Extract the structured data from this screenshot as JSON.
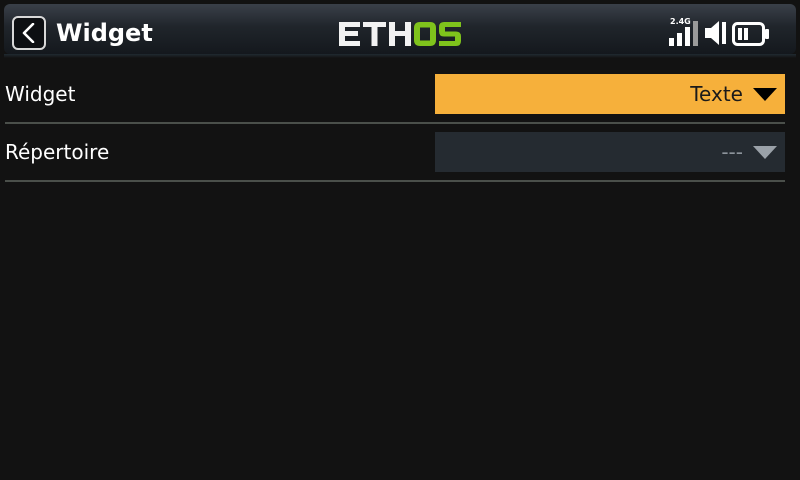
{
  "header": {
    "title": "Widget",
    "logo_text": "ETHOS",
    "rf_band": "2.4G",
    "colors": {
      "logo_white": "#f2f2f2",
      "logo_green": "#7fc31c"
    },
    "icons": [
      "back-arrow-icon",
      "signal-bars-icon",
      "speaker-icon",
      "battery-icon"
    ]
  },
  "form": {
    "rows": [
      {
        "label": "Widget",
        "value": "Texte",
        "state": "active",
        "accent": "#f6b03b"
      },
      {
        "label": "Répertoire",
        "value": "---",
        "state": "disabled"
      }
    ]
  }
}
